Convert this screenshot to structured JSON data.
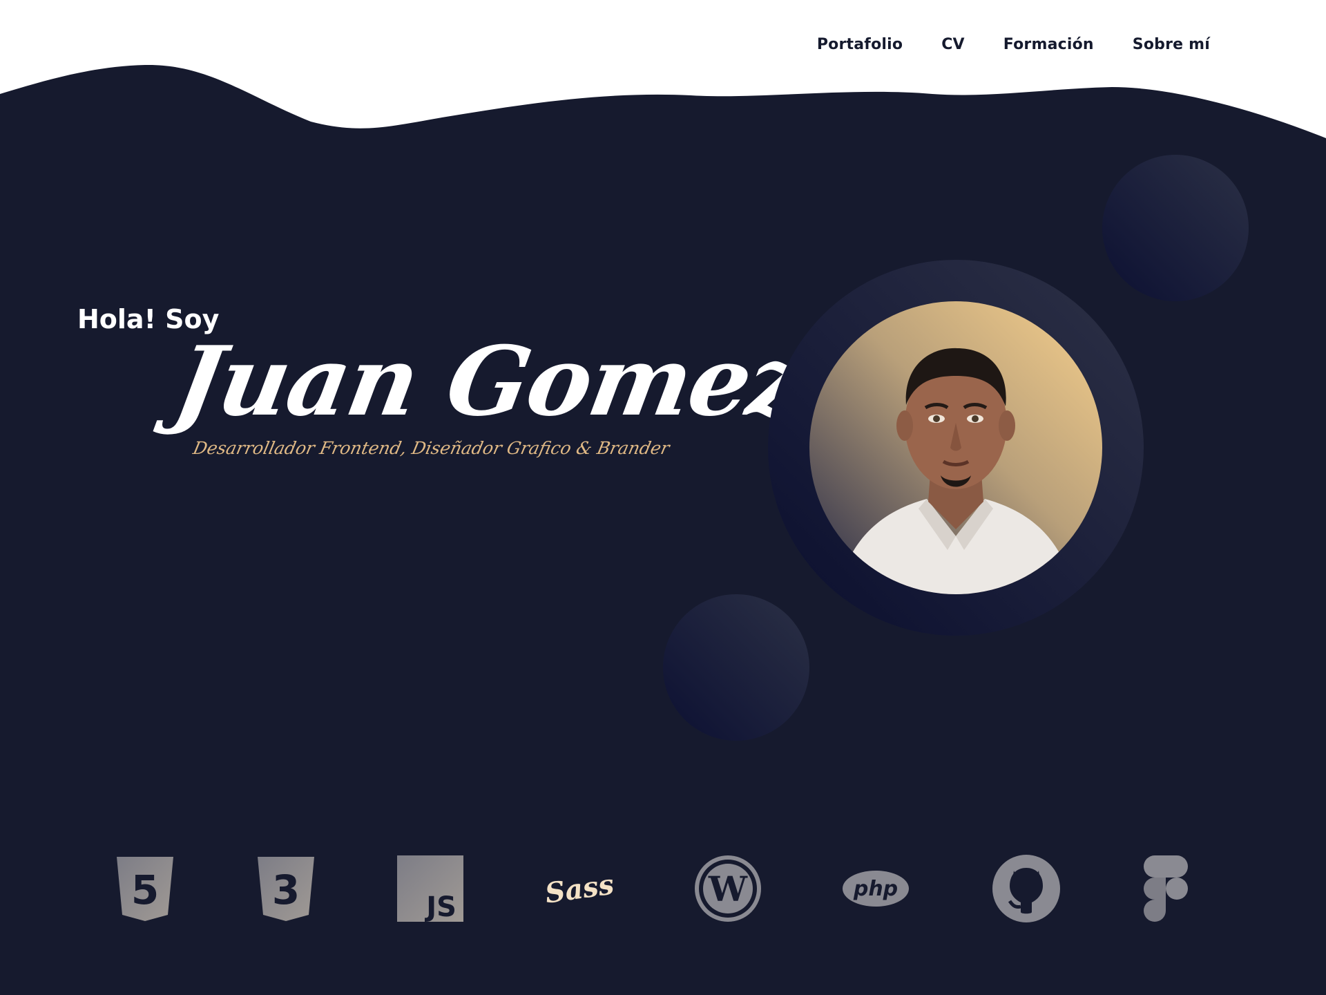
{
  "nav": {
    "items": [
      {
        "label": "Portafolio"
      },
      {
        "label": "CV"
      },
      {
        "label": "Formación"
      },
      {
        "label": "Sobre mí"
      }
    ]
  },
  "hero": {
    "greeting": "Hola! Soy",
    "name": "Juan Gomez",
    "tagline": "Desarrollador Frontend, Diseñador Grafico & Brander"
  },
  "skills": [
    {
      "icon": "html5-icon",
      "glyph": "5"
    },
    {
      "icon": "css3-icon",
      "glyph": "3"
    },
    {
      "icon": "javascript-icon",
      "glyph": "JS"
    },
    {
      "icon": "sass-icon",
      "glyph": "Sass"
    },
    {
      "icon": "wordpress-icon",
      "glyph": "W"
    },
    {
      "icon": "php-icon",
      "glyph": "php"
    },
    {
      "icon": "github-icon",
      "glyph": ""
    },
    {
      "icon": "figma-icon",
      "glyph": ""
    }
  ],
  "colors": {
    "background": "#161a2e",
    "accent_gold": "#e0b985",
    "icon_gray": "#8a8a92",
    "nav_text": "#151a2e"
  }
}
